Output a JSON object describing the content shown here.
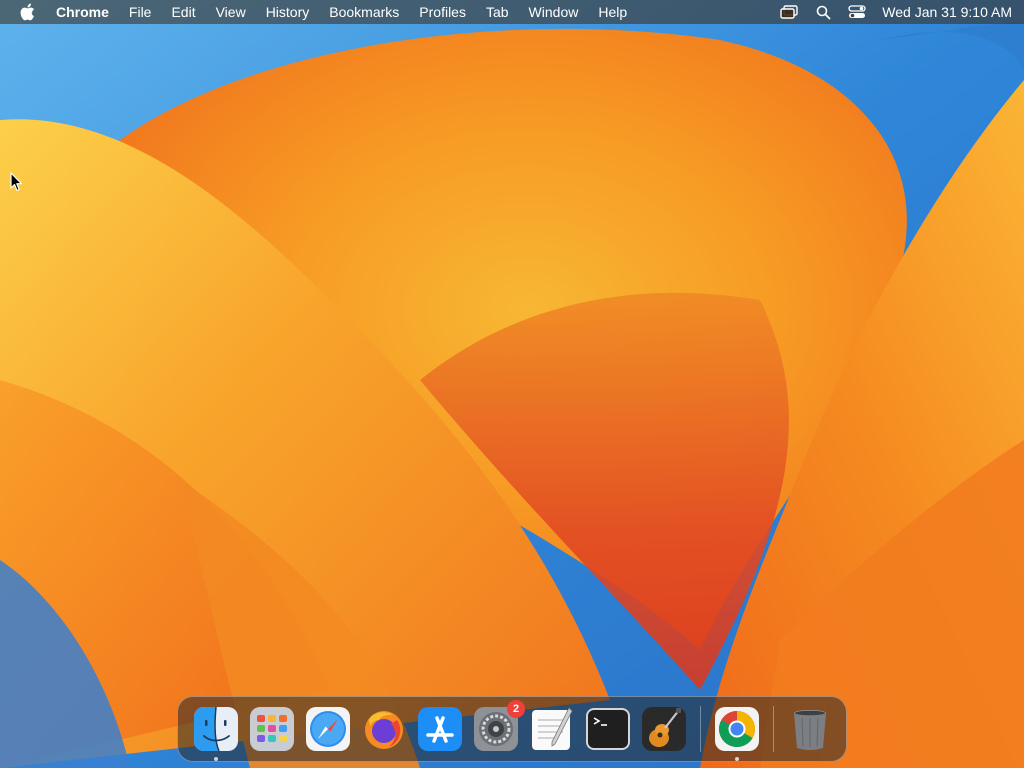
{
  "menubar": {
    "apple_icon": "apple-logo-icon",
    "app_name": "Chrome",
    "menus": [
      "File",
      "Edit",
      "View",
      "History",
      "Bookmarks",
      "Profiles",
      "Tab",
      "Window",
      "Help"
    ],
    "status_icons": [
      "screen-mirroring-icon",
      "spotlight-search-icon",
      "control-center-icon"
    ],
    "clock": "Wed Jan 31  9:10 AM"
  },
  "dock": {
    "apps": [
      {
        "name": "Finder",
        "icon": "finder-icon",
        "running": true
      },
      {
        "name": "Launchpad",
        "icon": "launchpad-icon",
        "running": false
      },
      {
        "name": "Safari",
        "icon": "safari-icon",
        "running": false
      },
      {
        "name": "Firefox",
        "icon": "firefox-icon",
        "running": false
      },
      {
        "name": "App Store",
        "icon": "app-store-icon",
        "running": false
      },
      {
        "name": "System Settings",
        "icon": "system-settings-icon",
        "running": false,
        "badge": "2"
      },
      {
        "name": "TextEdit",
        "icon": "textedit-icon",
        "running": false
      },
      {
        "name": "Terminal",
        "icon": "terminal-icon",
        "running": false
      },
      {
        "name": "GarageBand",
        "icon": "garageband-icon",
        "running": false
      }
    ],
    "recent": [
      {
        "name": "Google Chrome",
        "icon": "chrome-icon",
        "running": true
      }
    ],
    "trash": {
      "name": "Trash",
      "icon": "trash-icon"
    }
  },
  "colors": {
    "wallpaper_blue": "#2f7fd0",
    "wallpaper_orange": "#f7941d",
    "wallpaper_red": "#e5482a",
    "badge_red": "#f0403a"
  }
}
